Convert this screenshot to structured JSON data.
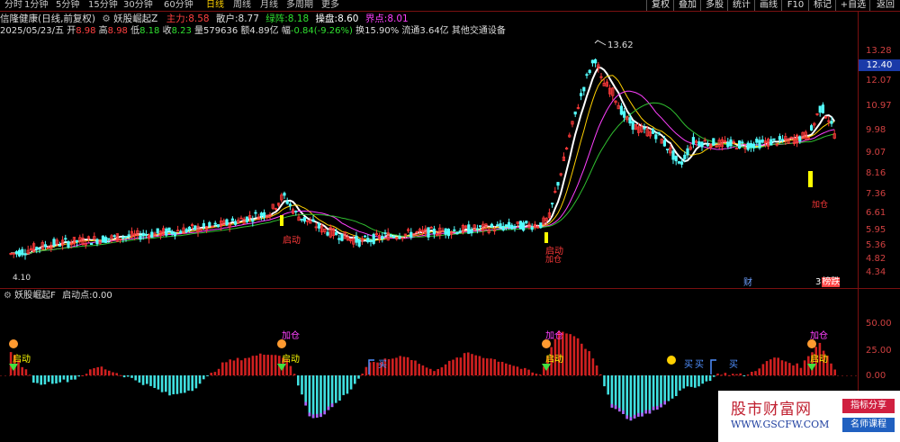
{
  "toolbar": {
    "periods": [
      "分时",
      "1分钟",
      "5分钟",
      "15分钟",
      "30分钟",
      "60分钟",
      "日线",
      "周线",
      "月线",
      "多周期",
      "更多"
    ],
    "active_period": "日线",
    "right_buttons": [
      "复权",
      "叠加",
      "多股",
      "统计",
      "画线",
      "F10",
      "标记",
      "+自选",
      "返回"
    ]
  },
  "info": {
    "stock_name": "信隆健康",
    "mode": "(日线,前复权)",
    "indicator_name": "妖股崛起Z",
    "labels": {
      "main_force": "主力:",
      "retail": "散户:",
      "green": "绿阵:",
      "control": "操盘:",
      "bound": "界点:"
    },
    "values": {
      "main_force": "8.58",
      "retail": "8.77",
      "green": "8.18",
      "control": "8.60",
      "bound": "8.01"
    }
  },
  "quote": {
    "date": "2025/05/23/五",
    "open_label": "开",
    "open": "8.98",
    "high_label": "高",
    "high": "8.98",
    "low_label": "低",
    "low": "8.18",
    "close_label": "收",
    "close": "8.23",
    "volume_label": "量",
    "volume": "579636",
    "amount_label": "额",
    "amount": "4.89亿",
    "change_label": "幅",
    "change": "-0.84(-9.26%)",
    "turnover": "换15.90%",
    "float": "流通3.64亿",
    "sector": "其他交通设备"
  },
  "indicator2": {
    "name": "妖股崛起F",
    "label": "启动点:",
    "value": "0.00"
  },
  "price_axis": [
    "13.28",
    "12.40",
    "12.07",
    "10.97",
    "9.98",
    "9.07",
    "8.16",
    "7.36",
    "6.61",
    "5.95",
    "5.36",
    "4.82",
    "4.34"
  ],
  "current_price_tag": "12.40",
  "osc_axis": [
    "50.00",
    "25.00",
    "0.00"
  ],
  "annotations": {
    "high": "13.62",
    "low": "4.10",
    "qidong": "启动",
    "jiacang": "加仓",
    "buy": "买",
    "cai": "财",
    "bangdie": "榜跌",
    "bangdie_num": "3"
  },
  "watermark": {
    "title": "股市财富网",
    "url": "WWW.GSCFW.COM",
    "badge1": "指标分享",
    "badge2": "名师课程"
  },
  "colors": {
    "up": "#ff3a3a",
    "down": "#54ffff",
    "yellow": "#ffff00",
    "bg": "#000000"
  },
  "chart_data": {
    "type": "candlestick",
    "title": "信隆健康 (日线,前复权)",
    "ylim": [
      4.1,
      13.62
    ],
    "annotated_high": 13.62,
    "annotated_low": 4.1,
    "last_close": 8.23,
    "osc_ylim": [
      -50,
      65
    ]
  }
}
